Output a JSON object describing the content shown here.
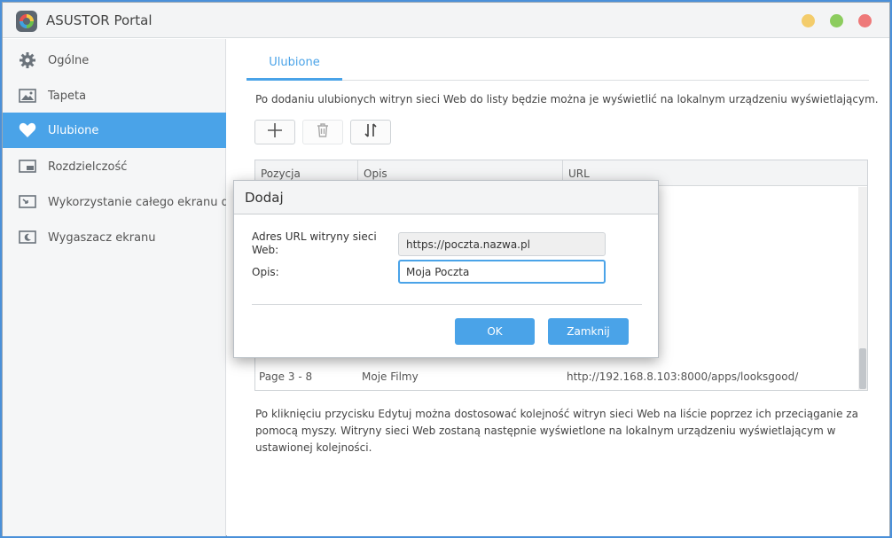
{
  "app": {
    "title": "ASUSTOR Portal",
    "logo_icon": "asustor-portal-logo"
  },
  "sidebar": {
    "items": [
      {
        "label": "Ogólne",
        "icon": "gear-icon"
      },
      {
        "label": "Tapeta",
        "icon": "image-icon"
      },
      {
        "label": "Ulubione",
        "icon": "heart-icon",
        "active": true
      },
      {
        "label": "Rozdzielczość",
        "icon": "screen-resolution-icon"
      },
      {
        "label": "Wykorzystanie całego ekranu do",
        "icon": "fullscreen-icon"
      },
      {
        "label": "Wygaszacz ekranu",
        "icon": "screensaver-icon"
      }
    ]
  },
  "main": {
    "tab": "Ulubione",
    "description_top": "Po dodaniu ulubionych witryn sieci Web do listy będzie można je wyświetlić na lokalnym urządzeniu wyświetlającym.",
    "toolbar": {
      "add_icon": "plus-icon",
      "delete_icon": "trash-icon",
      "sort_icon": "sort-arrows-icon"
    },
    "table": {
      "headers": [
        "Pozycja",
        "Opis",
        "URL"
      ],
      "rows": [
        {
          "pos": "Page 3 - 8",
          "opis": "Moje Filmy",
          "url": "http://192.168.8.103:8000/apps/looksgood/"
        }
      ]
    },
    "description_bottom": "Po kliknięciu przycisku Edytuj można dostosować kolejność witryn sieci Web na liście poprzez ich przeciąganie za pomocą myszy. Witryny sieci Web zostaną następnie wyświetlone na lokalnym urządzeniu wyświetlającym w ustawionej kolejności."
  },
  "dialog": {
    "title": "Dodaj",
    "url_label": "Adres URL witryny sieci Web:",
    "url_value": "https://poczta.nazwa.pl",
    "opis_label": "Opis:",
    "opis_value": "Moja Poczta",
    "ok_label": "OK",
    "close_label": "Zamknij"
  },
  "colors": {
    "accent": "#4aa3e8",
    "sidebar_bg": "#f5f6f7",
    "min": "#f3cc6b",
    "max": "#8ccc5e",
    "close": "#ee7979"
  }
}
